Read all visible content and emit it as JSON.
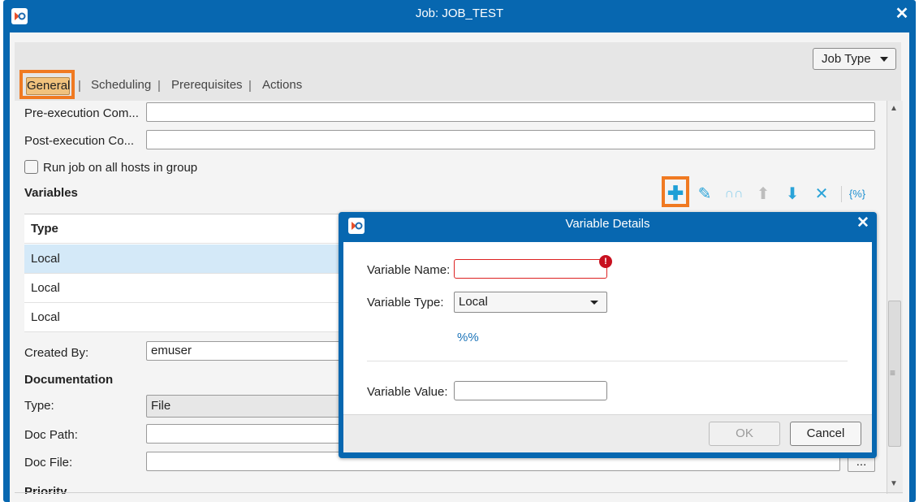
{
  "window": {
    "title": "Job: JOB_TEST"
  },
  "toolbar": {
    "job_type_label": "Job Type"
  },
  "tabs": [
    {
      "label": "General"
    },
    {
      "label": "Scheduling"
    },
    {
      "label": "Prerequisites"
    },
    {
      "label": "Actions"
    }
  ],
  "tab_separator": "|",
  "form": {
    "pre_exec_label": "Pre-execution Com...",
    "pre_exec_value": "",
    "post_exec_label": "Post-execution Co...",
    "post_exec_value": "",
    "run_on_all_hosts_label": "Run job on all hosts in group",
    "variables_heading": "Variables",
    "var_table": {
      "column_header": "Type",
      "rows": [
        {
          "type": "Local"
        },
        {
          "type": "Local"
        },
        {
          "type": "Local"
        }
      ]
    },
    "created_by_label": "Created By:",
    "created_by_value": "emuser",
    "documentation_heading": "Documentation",
    "type_label": "Type:",
    "type_value": "File",
    "doc_path_label": "Doc Path:",
    "doc_file_label": "Doc File:",
    "browse_label": "...",
    "priority_heading": "Priority"
  },
  "variable_icons": [
    "add-icon",
    "edit-icon",
    "copy-icon",
    "move-up-icon",
    "move-down-icon",
    "delete-icon",
    "variable-braces-icon"
  ],
  "dialog": {
    "title": "Variable Details",
    "name_label": "Variable Name:",
    "name_value": "",
    "error_glyph": "!",
    "type_label": "Variable Type:",
    "type_value": "Local",
    "percent_label": "%%",
    "value_label": "Variable Value:",
    "value_value": "",
    "ok_label": "OK",
    "cancel_label": "Cancel"
  },
  "colors": {
    "window_blue": "#0767b0",
    "highlight_orange": "#f07a22",
    "icon_cyan": "#2aa3d8",
    "error_red": "#c8101f",
    "selected_row": "#d4e9f8"
  }
}
